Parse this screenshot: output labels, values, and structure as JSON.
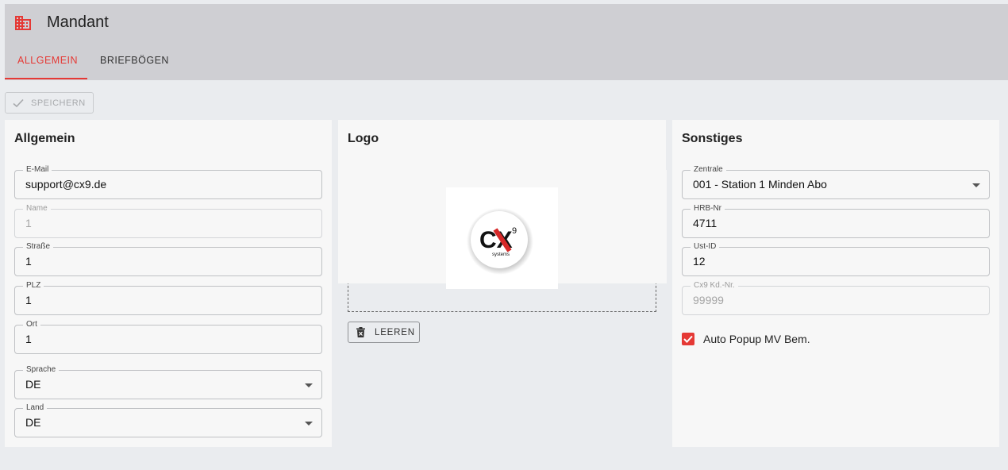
{
  "header": {
    "title": "Mandant",
    "tabs": [
      {
        "label": "Allgemein",
        "active": true
      },
      {
        "label": "Briefbögen",
        "active": false
      }
    ]
  },
  "toolbar": {
    "save_label": "SPEICHERN"
  },
  "general": {
    "title": "Allgemein",
    "fields": {
      "email": {
        "label": "E-Mail",
        "value": "support@cx9.de"
      },
      "name": {
        "label": "Name",
        "value": "1"
      },
      "street": {
        "label": "Straße",
        "value": "1"
      },
      "zip": {
        "label": "PLZ",
        "value": "1"
      },
      "city": {
        "label": "Ort",
        "value": "1"
      },
      "language": {
        "label": "Sprache",
        "value": "DE"
      },
      "country": {
        "label": "Land",
        "value": "DE"
      }
    }
  },
  "logo": {
    "title": "Logo",
    "clear_label": "LEEREN",
    "brand_text": "CX",
    "brand_superscript": "9",
    "brand_subtext": "systems"
  },
  "other": {
    "title": "Sonstiges",
    "fields": {
      "central": {
        "label": "Zentrale",
        "value": "001 - Station 1 Minden Abo"
      },
      "hrb": {
        "label": "HRB-Nr",
        "value": "4711"
      },
      "vat": {
        "label": "Ust-ID",
        "value": "12"
      },
      "customer_no": {
        "label": "Cx9 Kd.-Nr.",
        "value": "99999"
      }
    },
    "auto_popup": {
      "label": "Auto Popup MV Bem.",
      "checked": true
    }
  },
  "colors": {
    "accent": "#e53935",
    "header_bg": "#cfcfd3",
    "page_bg": "#eaecef",
    "card_bg": "#f7f7f7"
  },
  "icons": {
    "app": "building-icon",
    "save": "check-icon",
    "clear": "trash-icon",
    "dropdown": "caret-down-icon",
    "checkbox": "checkmark-icon"
  }
}
